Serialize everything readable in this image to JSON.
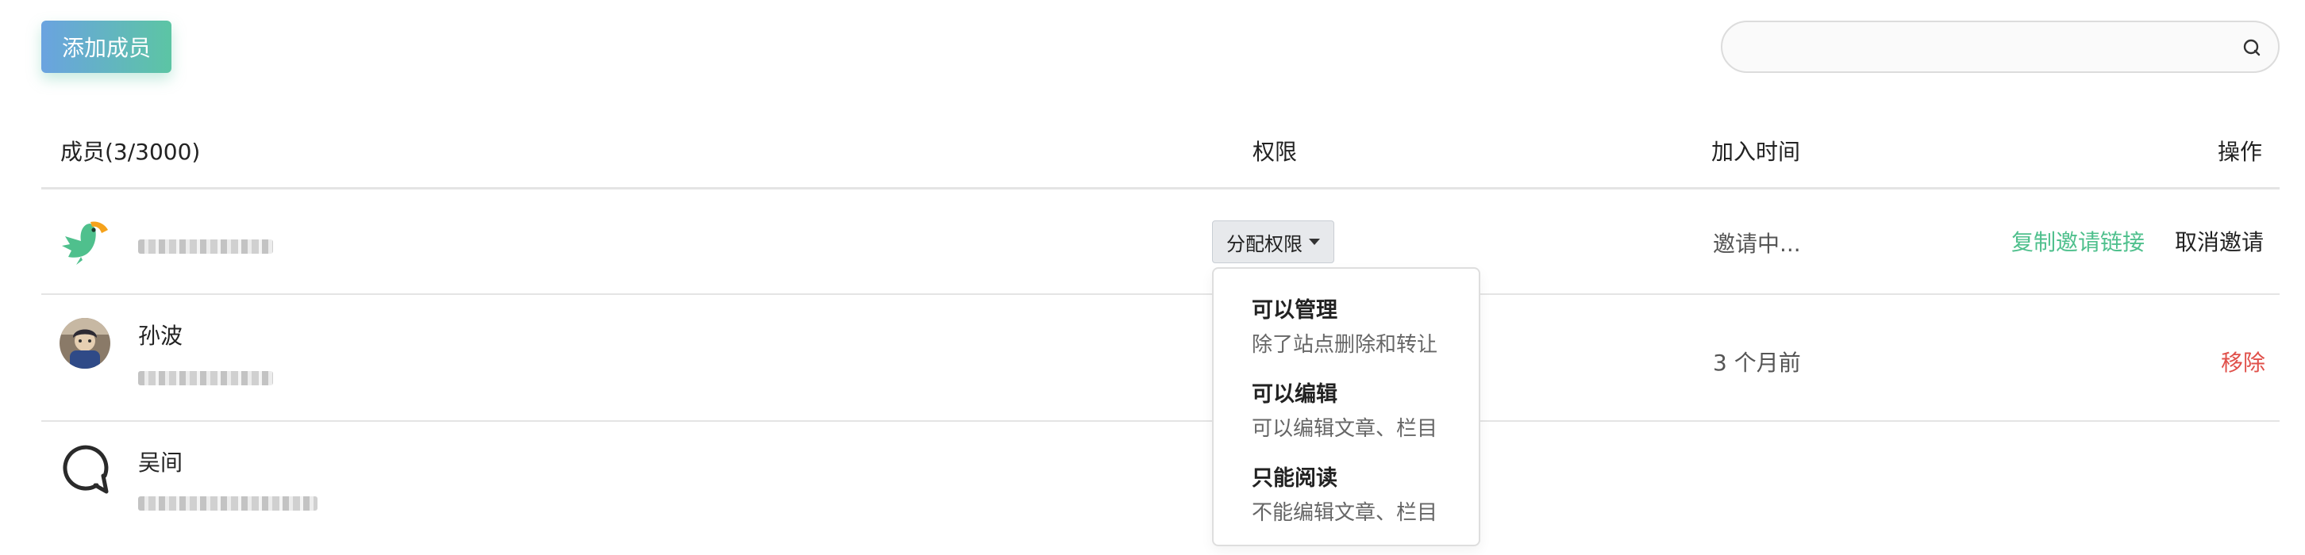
{
  "toolbar": {
    "add_member_label": "添加成员"
  },
  "search": {
    "value": "",
    "placeholder": "",
    "icon": "search-icon"
  },
  "table": {
    "headers": {
      "member": "成员(3/3000)",
      "permission": "权限",
      "join_time": "加入时间",
      "actions": "操作"
    },
    "rows": [
      {
        "avatar": "parrot-logo",
        "name": "",
        "status": "邀请中...",
        "permission_button": "分配权限",
        "actions": [
          "复制邀请链接",
          "取消邀请"
        ]
      },
      {
        "avatar": "user-photo",
        "name": "孙波",
        "join_time": "3 个月前",
        "actions": [
          "移除"
        ]
      },
      {
        "avatar": "chat-bubble-icon",
        "name": "吴间"
      }
    ]
  },
  "permission_menu": [
    {
      "title": "可以管理",
      "desc": "除了站点删除和转让"
    },
    {
      "title": "可以编辑",
      "desc": "可以编辑文章、栏目"
    },
    {
      "title": "只能阅读",
      "desc": "不能编辑文章、栏目"
    }
  ],
  "colors": {
    "accent": "#4fc08d",
    "danger": "#e0504a",
    "button_gradient": [
      "#6aa3e0",
      "#5cc5a4"
    ]
  }
}
